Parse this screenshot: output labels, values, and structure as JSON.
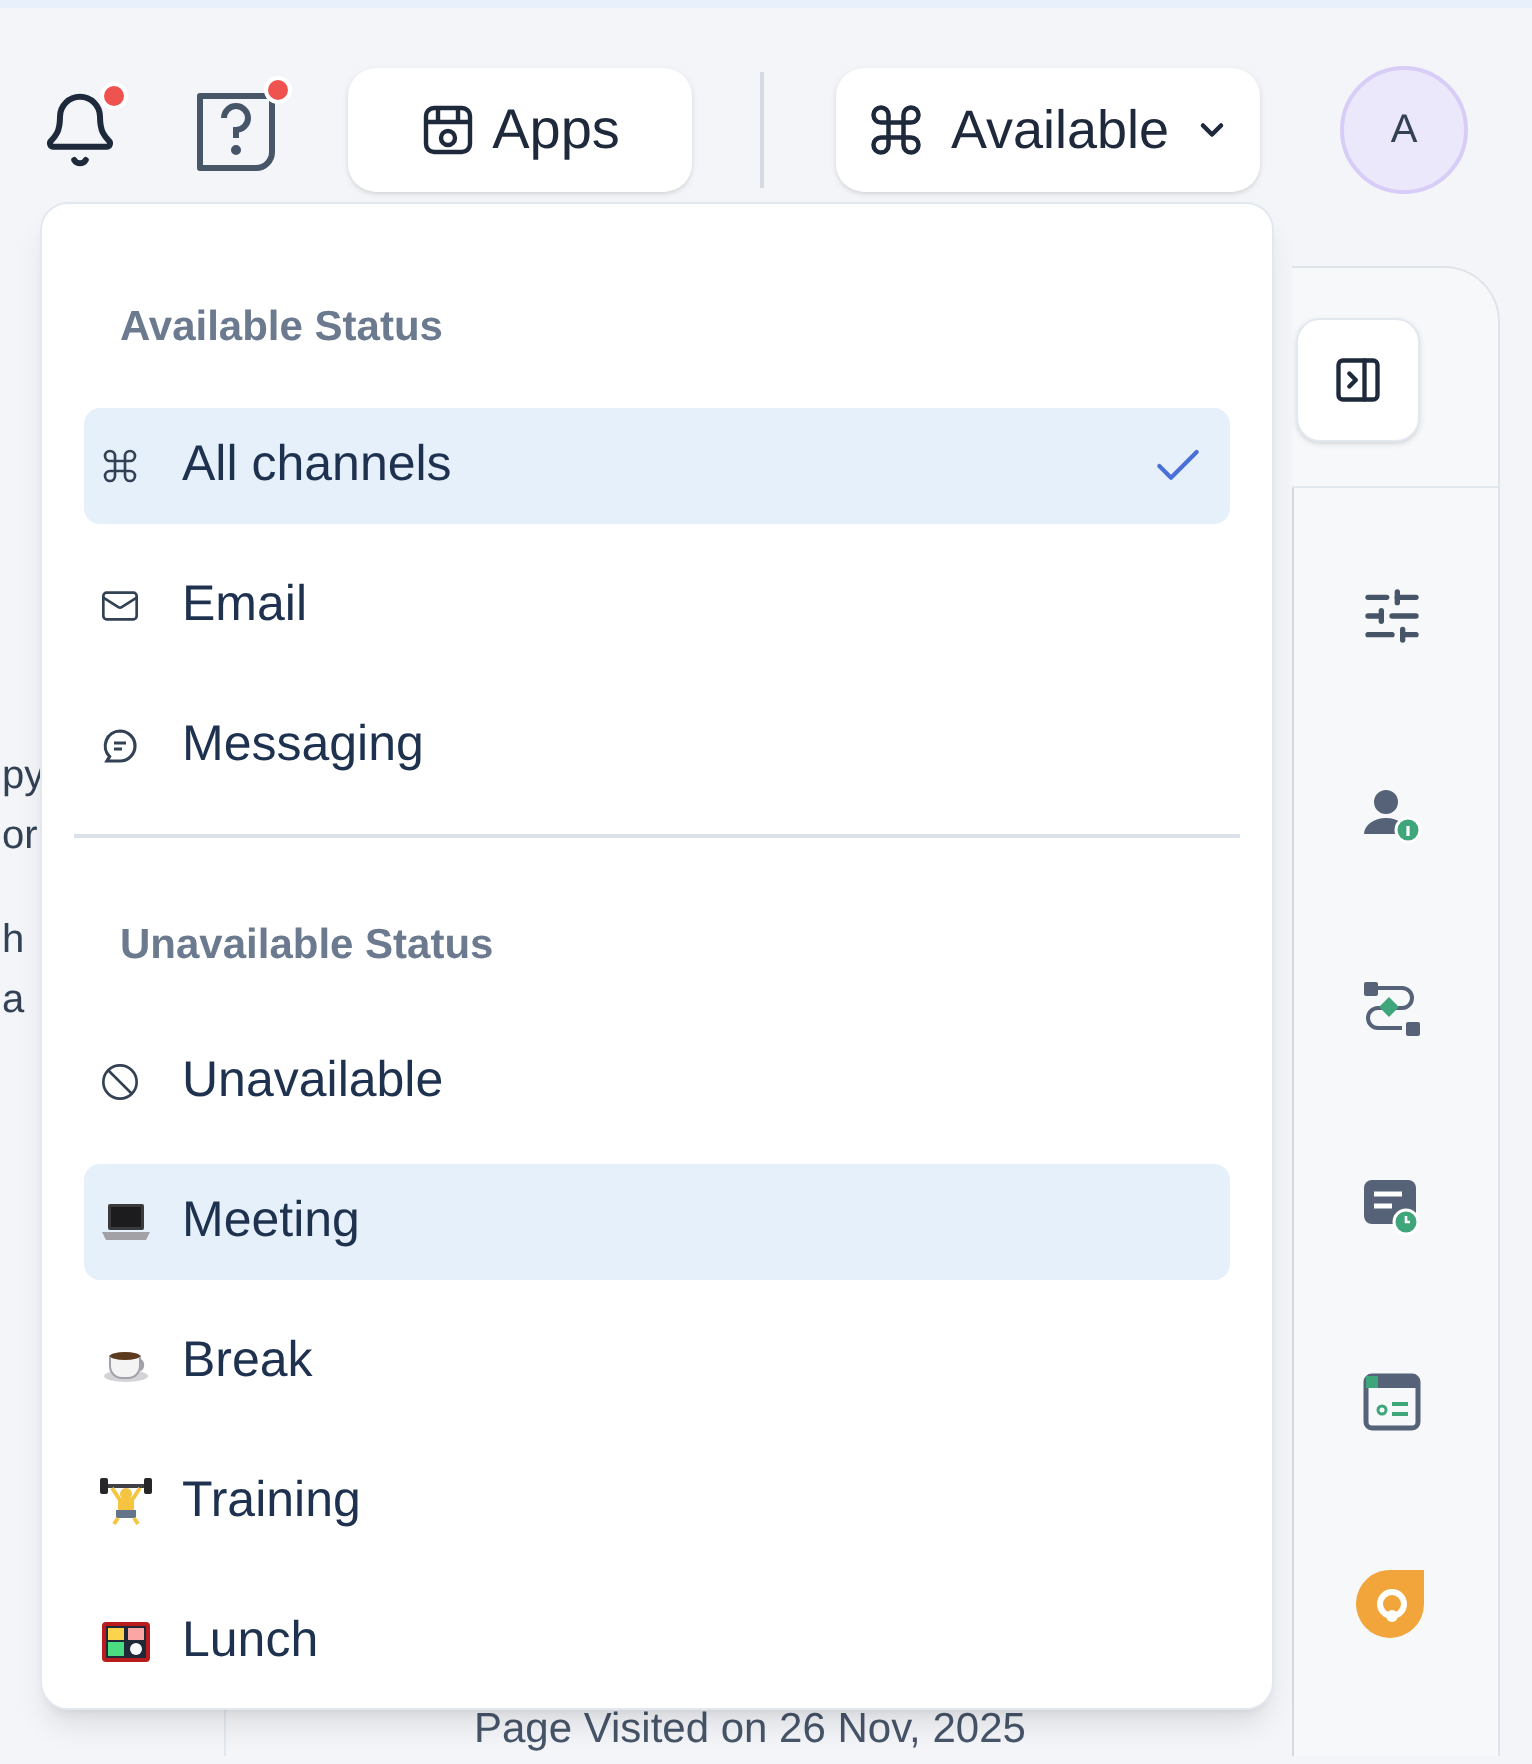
{
  "header": {
    "notifications": {
      "badge": true
    },
    "help": {
      "badge": true
    },
    "apps_button": "Apps",
    "status_button": "Available",
    "avatar": "A"
  },
  "background": {
    "text_fragments": [
      "py",
      "or",
      "h",
      "a"
    ],
    "footer_text": "Page Visited on 26 Nov, 2025"
  },
  "status_menu": {
    "sections": [
      {
        "title": "Available Status",
        "items": [
          {
            "label": "All channels",
            "selected": true,
            "highlighted": true
          },
          {
            "label": "Email",
            "selected": false,
            "highlighted": false
          },
          {
            "label": "Messaging",
            "selected": false,
            "highlighted": false
          }
        ]
      },
      {
        "title": "Unavailable Status",
        "items": [
          {
            "label": "Unavailable",
            "selected": false,
            "highlighted": false
          },
          {
            "label": "Meeting",
            "selected": false,
            "highlighted": true
          },
          {
            "label": "Break",
            "selected": false,
            "highlighted": false
          },
          {
            "label": "Training",
            "selected": false,
            "highlighted": false
          },
          {
            "label": "Lunch",
            "selected": false,
            "highlighted": false
          }
        ]
      }
    ]
  }
}
